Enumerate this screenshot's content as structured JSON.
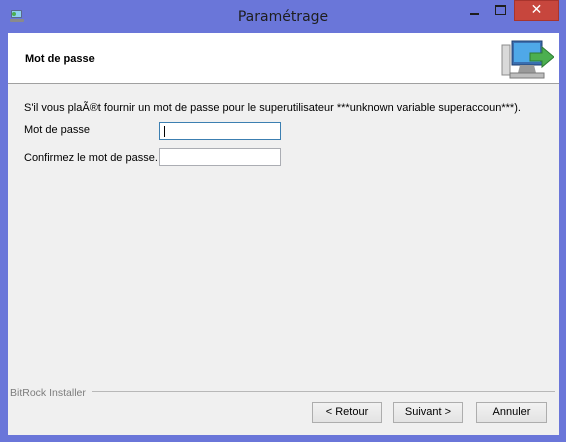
{
  "window": {
    "title": "Paramétrage",
    "close_glyph": "✕",
    "icons": {
      "app": "installer-app-icon",
      "minimize": "minimize-icon",
      "maximize": "maximize-icon",
      "close": "close-icon"
    }
  },
  "header": {
    "title": "Mot de passe",
    "logo_icon": "computer-install-logo"
  },
  "content": {
    "intro": "S'il vous plaÃ®t fournir un mot de passe pour le superutilisateur ***unknown variable superaccoun***).",
    "password_label": "Mot de passe",
    "password_value": "",
    "confirm_label": "Confirmez le mot de passe.",
    "confirm_value": ""
  },
  "footer": {
    "brand": "BitRock Installer",
    "back_label": "< Retour",
    "next_label": "Suivant >",
    "cancel_label": "Annuler"
  },
  "colors": {
    "frame": "#6a76d9",
    "close_button": "#c7463d",
    "client_bg": "#f0f0f0",
    "focus_border": "#3c7fb1"
  }
}
